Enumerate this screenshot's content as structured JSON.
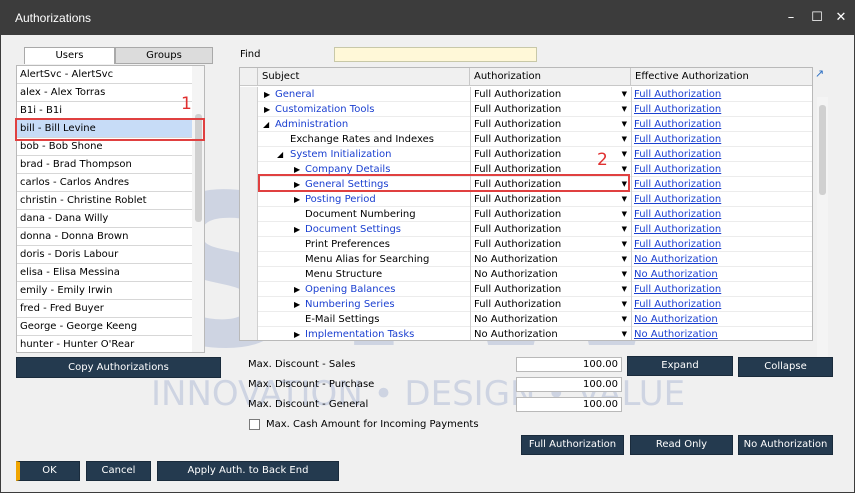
{
  "window": {
    "title": "Authorizations"
  },
  "tabs": {
    "users": "Users",
    "groups": "Groups"
  },
  "users": [
    "AlertSvc - AlertSvc",
    "alex - Alex Torras",
    "B1i - B1i",
    "bill - Bill Levine",
    "bob - Bob Shone",
    "brad - Brad Thompson",
    "carlos - Carlos Andres",
    "christin - Christine Roblet",
    "dana - Dana Willy",
    "donna - Donna Brown",
    "doris - Doris Labour",
    "elisa - Elisa Messina",
    "emily - Emily Irwin",
    "fred - Fred Buyer",
    "George - George Keeng",
    "hunter - Hunter O'Rear"
  ],
  "annotations": {
    "one": "1",
    "two": "2"
  },
  "find": {
    "label": "Find",
    "value": ""
  },
  "grid": {
    "headers": {
      "subject": "Subject",
      "authorization": "Authorization",
      "effective": "Effective Authorization"
    },
    "rows": [
      {
        "subject": "General",
        "auth": "Full Authorization",
        "effective": "Full Authorization"
      },
      {
        "subject": "Customization Tools",
        "auth": "Full Authorization",
        "effective": "Full Authorization"
      },
      {
        "subject": "Administration",
        "auth": "Full Authorization",
        "effective": "Full Authorization"
      },
      {
        "subject": "Exchange Rates and Indexes",
        "auth": "Full Authorization",
        "effective": "Full Authorization"
      },
      {
        "subject": "System Initialization",
        "auth": "Full Authorization",
        "effective": "Full Authorization"
      },
      {
        "subject": "Company Details",
        "auth": "Full Authorization",
        "effective": "Full Authorization"
      },
      {
        "subject": "General Settings",
        "auth": "Full Authorization",
        "effective": "Full Authorization"
      },
      {
        "subject": "Posting Period",
        "auth": "Full Authorization",
        "effective": "Full Authorization"
      },
      {
        "subject": "Document Numbering",
        "auth": "Full Authorization",
        "effective": "Full Authorization"
      },
      {
        "subject": "Document Settings",
        "auth": "Full Authorization",
        "effective": "Full Authorization"
      },
      {
        "subject": "Print Preferences",
        "auth": "Full Authorization",
        "effective": "Full Authorization"
      },
      {
        "subject": "Menu Alias for Searching",
        "auth": "No Authorization",
        "effective": "No Authorization"
      },
      {
        "subject": "Menu Structure",
        "auth": "No Authorization",
        "effective": "No Authorization"
      },
      {
        "subject": "Opening Balances",
        "auth": "Full Authorization",
        "effective": "Full Authorization"
      },
      {
        "subject": "Numbering Series",
        "auth": "Full Authorization",
        "effective": "Full Authorization"
      },
      {
        "subject": "E-Mail Settings",
        "auth": "No Authorization",
        "effective": "No Authorization"
      },
      {
        "subject": "Implementation Tasks",
        "auth": "No Authorization",
        "effective": "No Authorization"
      }
    ]
  },
  "fields": {
    "max_discount_sales": {
      "label": "Max. Discount - Sales",
      "value": "100.00"
    },
    "max_discount_purchase": {
      "label": "Max. Discount - Purchase",
      "value": "100.00"
    },
    "max_discount_general": {
      "label": "Max. Discount - General",
      "value": "100.00"
    },
    "max_cash_label": "Max. Cash Amount for Incoming Payments"
  },
  "buttons": {
    "copy_auth": "Copy Authorizations",
    "expand": "Expand",
    "collapse": "Collapse",
    "full_auth": "Full Authorization",
    "read_only": "Read Only",
    "no_auth": "No Authorization",
    "ok": "OK",
    "cancel": "Cancel",
    "apply": "Apply Auth. to Back End"
  },
  "watermark": {
    "line": "INNOVATION • DESIGN • VALUE"
  },
  "colors": {
    "titlebar": "#3c3c3c",
    "button": "#243a4f",
    "accent": "#f0a500",
    "link": "#1a3fd0",
    "highlight": "#e04040"
  }
}
